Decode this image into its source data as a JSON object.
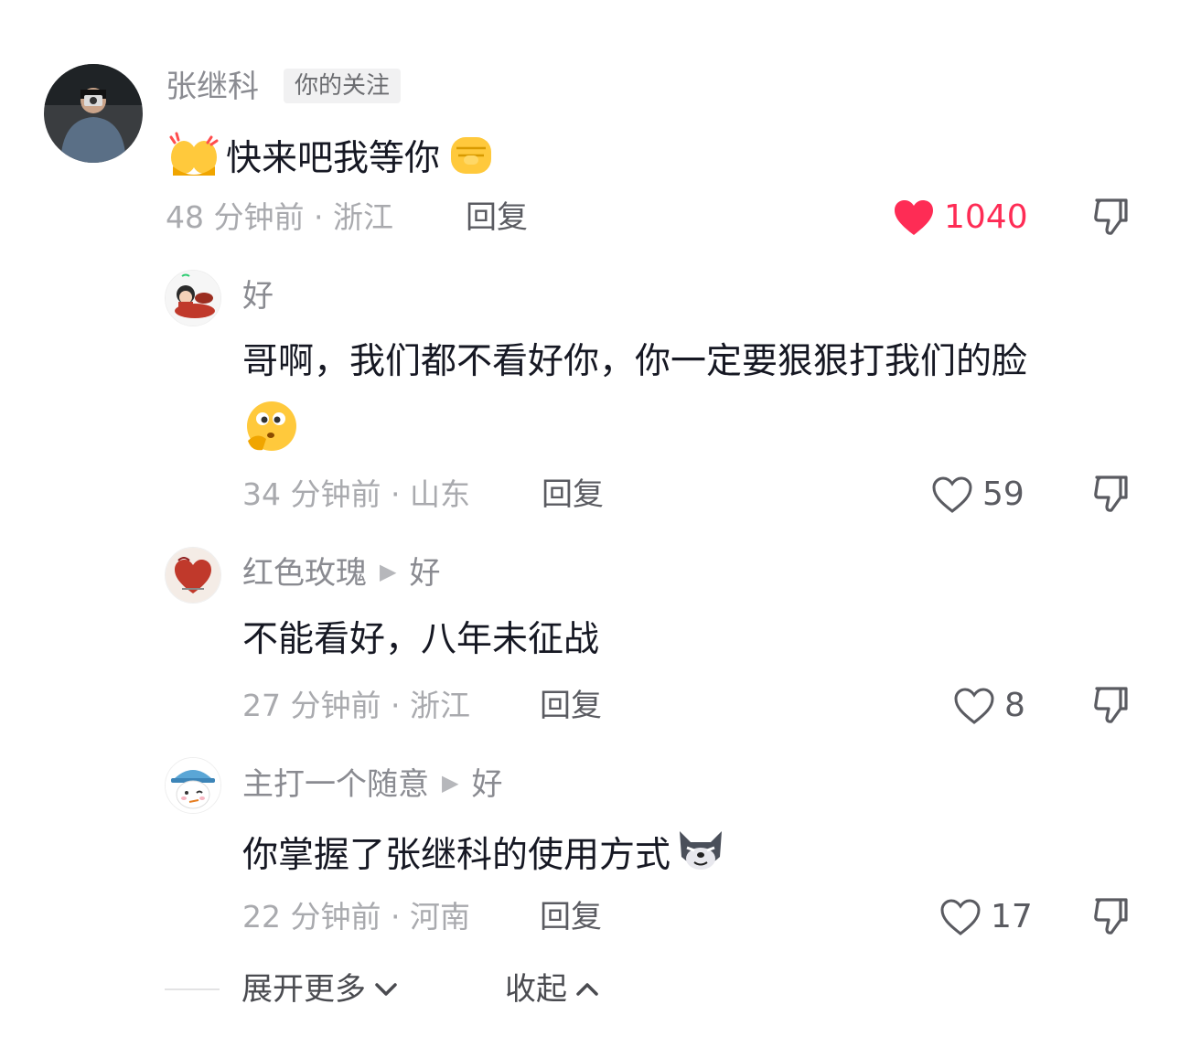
{
  "comments": [
    {
      "username": "张继科",
      "tag": "你的关注",
      "text": "快来吧我等你",
      "time_location": "48 分钟前 · 浙江",
      "reply_label": "回复",
      "likes": "1040",
      "liked": true
    },
    {
      "username": "好",
      "text": "哥啊，我们都不看好你，你一定要狠狠打我们的脸",
      "time_location": "34 分钟前 · 山东",
      "reply_label": "回复",
      "likes": "59",
      "liked": false
    },
    {
      "username": "红色玫瑰",
      "reply_to": "好",
      "text": "不能看好，八年未征战",
      "time_location": "27 分钟前 · 浙江",
      "reply_label": "回复",
      "likes": "8",
      "liked": false
    },
    {
      "username": "主打一个随意",
      "reply_to": "好",
      "text": "你掌握了张继科的使用方式",
      "time_location": "22 分钟前 · 河南",
      "reply_label": "回复",
      "likes": "17",
      "liked": false
    }
  ],
  "footer": {
    "expand_label": "展开更多",
    "collapse_label": "收起"
  },
  "colors": {
    "like_red": "#fe2c55",
    "meta_gray": "#a9aaae",
    "username_gray": "#8a8b91",
    "text_dark": "#161823"
  },
  "icons": {
    "heart_filled": "heart-filled-icon",
    "heart_outline": "heart-outline-icon",
    "dislike": "thumbs-down-icon",
    "chevron_down": "chevron-down-icon",
    "chevron_up": "chevron-up-icon",
    "reply_arrow": "play-arrow-icon"
  }
}
